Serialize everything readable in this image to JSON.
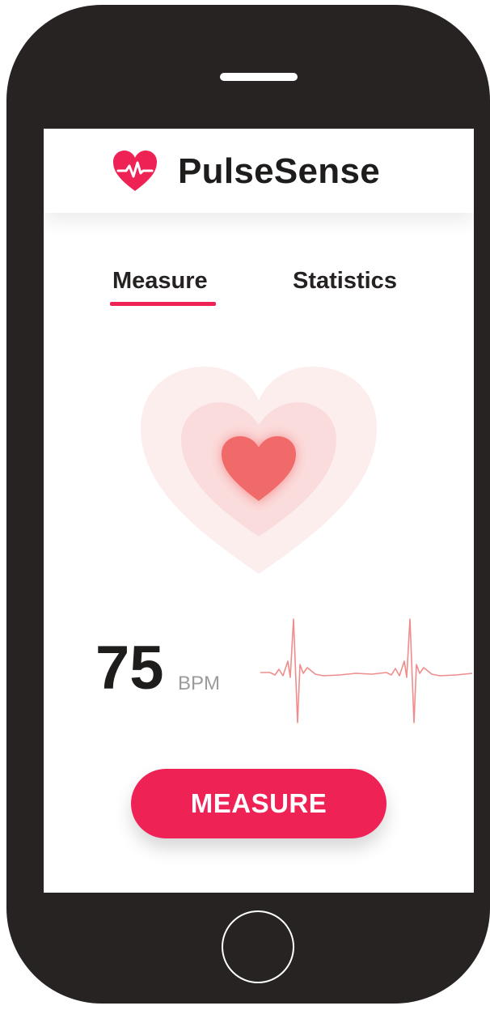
{
  "app": {
    "title": "PulseSense",
    "logo_icon": "heart-pulse-icon"
  },
  "tabs": [
    {
      "label": "Measure",
      "active": true
    },
    {
      "label": "Statistics",
      "active": false
    }
  ],
  "reading": {
    "value": "75",
    "unit": "BPM"
  },
  "actions": {
    "measure_label": "MEASURE"
  },
  "colors": {
    "accent": "#ef2256",
    "heart_core": "#f06a6a",
    "ecg_line": "#f08c8c",
    "phone_body": "#262322"
  }
}
